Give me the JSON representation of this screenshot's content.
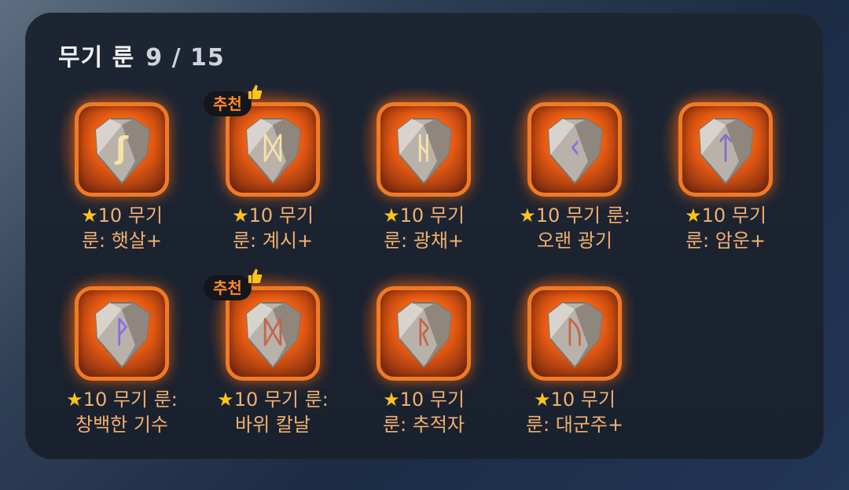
{
  "header": {
    "title": "무기 룬",
    "count": "9 / 15"
  },
  "badge_label": "추천",
  "runes": [
    {
      "star": "★",
      "stars": "10",
      "text": "무기 룬: 햇살+",
      "line1": "10 무기",
      "line2": "룬: 햇살+",
      "glyph": "ʃ",
      "glyph_color": "#f6e3a6",
      "recommended": false
    },
    {
      "star": "★",
      "stars": "10",
      "text": "무기 룬: 계시+",
      "line1": "10 무기",
      "line2": "룬: 계시+",
      "glyph": "ᛞ",
      "glyph_color": "#f6e3a6",
      "recommended": true
    },
    {
      "star": "★",
      "stars": "10",
      "text": "무기 룬: 광채+",
      "line1": "10 무기",
      "line2": "룬: 광채+",
      "glyph": "ᚺ",
      "glyph_color": "#f6e3a6",
      "recommended": false
    },
    {
      "star": "★",
      "stars": "10",
      "text": "무기 룬: 오랜 광기",
      "line1": "10 무기 룬:",
      "line2": "오랜 광기",
      "glyph": "ᚲ",
      "glyph_color": "#8b6de0",
      "recommended": false
    },
    {
      "star": "★",
      "stars": "10",
      "text": "무기 룬: 암운+",
      "line1": "10 무기",
      "line2": "룬: 암운+",
      "glyph": "ᛏ",
      "glyph_color": "#7c70c8",
      "recommended": false
    },
    {
      "star": "★",
      "stars": "10",
      "text": "무기 룬: 창백한 기수",
      "line1": "10 무기 룬:",
      "line2": "창백한 기수",
      "glyph": "ᚹ",
      "glyph_color": "#8b6de0",
      "recommended": false
    },
    {
      "star": "★",
      "stars": "10",
      "text": "무기 룬: 바위 칼날",
      "line1": "10 무기 룬:",
      "line2": "바위 칼날",
      "glyph": "ᛞ",
      "glyph_color": "#c4664a",
      "recommended": true
    },
    {
      "star": "★",
      "stars": "10",
      "text": "무기 룬: 추적자",
      "line1": "10 무기",
      "line2": "룬: 추적자",
      "glyph": "ᚱ",
      "glyph_color": "#c4664a",
      "recommended": false
    },
    {
      "star": "★",
      "stars": "10",
      "text": "무기 룬: 대군주+",
      "line1": "10 무기",
      "line2": "룬: 대군주+",
      "glyph": "ᚢ",
      "glyph_color": "#c4664a",
      "recommended": false
    }
  ]
}
